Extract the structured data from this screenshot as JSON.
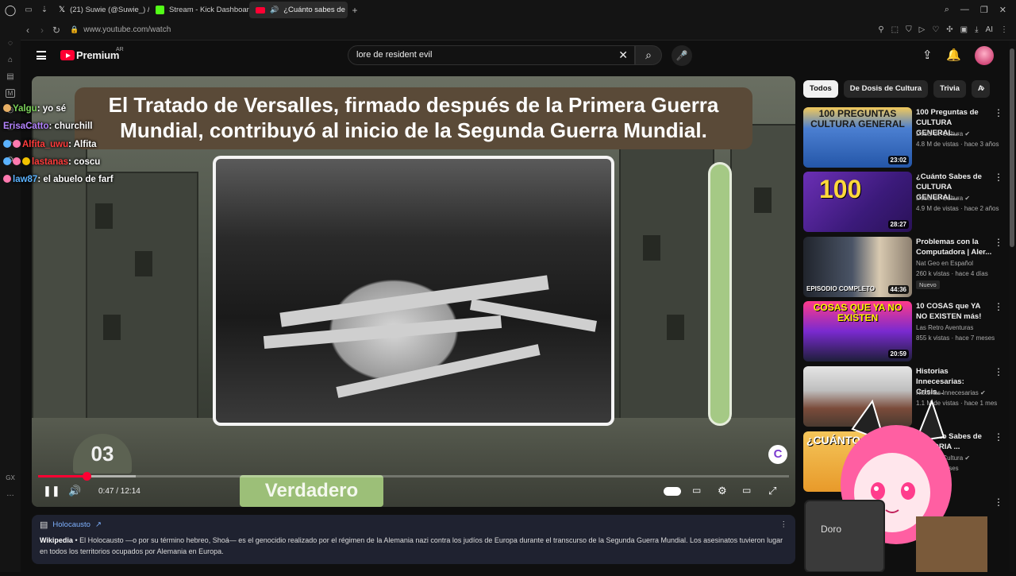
{
  "browser": {
    "tabs": [
      {
        "label": "(21) Suwie (@Suwie_) / X",
        "icon": "x-logo-icon"
      },
      {
        "label": "Stream - Kick Dashboard",
        "icon": "kick-logo-icon"
      },
      {
        "label": "¿Cuánto sabes de la S",
        "icon": "youtube-logo-icon",
        "active": true
      }
    ],
    "url": "www.youtube.com/watch",
    "ai_label": "AI"
  },
  "youtube": {
    "brand": "Premium",
    "region": "AR",
    "search_value": "lore de resident evil"
  },
  "video": {
    "question_line1": "El Tratado de Versalles, firmado después de la Primera Guerra",
    "question_line2": "Mundial, contribuyó al inicio de la Segunda Guerra Mundial.",
    "question_number": "03",
    "answer": "Verdadero",
    "time": "0:47 / 12:14",
    "progress": 0.064,
    "buffered": 0.13
  },
  "chat": [
    {
      "user": "Yalgu",
      "msg": ": yo sé",
      "color": "#7cd35a"
    },
    {
      "user": "ErisaCatto",
      "msg": ": churchill",
      "color": "#b483ff"
    },
    {
      "user": "Alfita_uwu",
      "msg": ": Alfita",
      "color": "#ff3b3b"
    },
    {
      "user": "lastanas",
      "msg": ": coscu",
      "color": "#ff3b3b"
    },
    {
      "user": "law87",
      "msg": ": el abuelo de farf",
      "color": "#5bb3ff"
    }
  ],
  "info_card": {
    "title": "Holocausto",
    "source": "Wikipedia",
    "text": "• El Holocausto —o por su término hebreo, Shoá— es el genocidio realizado por el régimen de la Alemania nazi contra los judíos de Europa durante el transcurso de la Segunda Guerra Mundial. Los asesinatos tuvieron lugar en todos los territorios ocupados por Alemania en Europa."
  },
  "chips": [
    "Todos",
    "De Dosis de Cultura",
    "Trivia",
    "A"
  ],
  "recommendations": [
    {
      "title": "100 Preguntas de CULTURA GENERAL...",
      "channel": "Dosis de Cultura",
      "meta": "4.8 M de vistas · hace 3 años",
      "duration": "23:02",
      "thumb_text": "100 PREGUNTAS CULTURA GENERAL",
      "verified": true
    },
    {
      "title": "¿Cuánto Sabes de CULTURA GENERAL...",
      "channel": "Dosis de Cultura",
      "meta": "4.9 M de vistas · hace 2 años",
      "duration": "28:27",
      "thumb_text": "100",
      "verified": true
    },
    {
      "title": "Problemas con la Computadora | Aler...",
      "channel": "Nat Geo en Español",
      "meta": "260 k vistas · hace 4 días",
      "duration": "44:36",
      "thumb_text": "EPISODIO COMPLETO",
      "badge": "Nuevo"
    },
    {
      "title": "10 COSAS que YA NO EXISTEN más!",
      "channel": "Las Retro Aventuras",
      "meta": "855 k vistas · hace 7 meses",
      "duration": "20:59",
      "thumb_text": "COSAS QUE YA NO EXISTEN"
    },
    {
      "title": "Historias Innecesarias: Crisis...",
      "channel": "Historias Innecesarias",
      "meta": "1.1 M de vistas · hace 1 mes",
      "duration": "",
      "thumb_text": "",
      "verified": true
    },
    {
      "title": "¿Cuánto Sabes de HISTORIA ...",
      "channel": "Dosis de Cultura",
      "meta": "hace 11 meses",
      "duration": "",
      "thumb_text": "¿CUÁNTO HIST",
      "verified": true
    }
  ],
  "colors": {
    "accent": "#ff0033",
    "answer_green": "#9cbf78",
    "banner": "#5a4a38"
  }
}
